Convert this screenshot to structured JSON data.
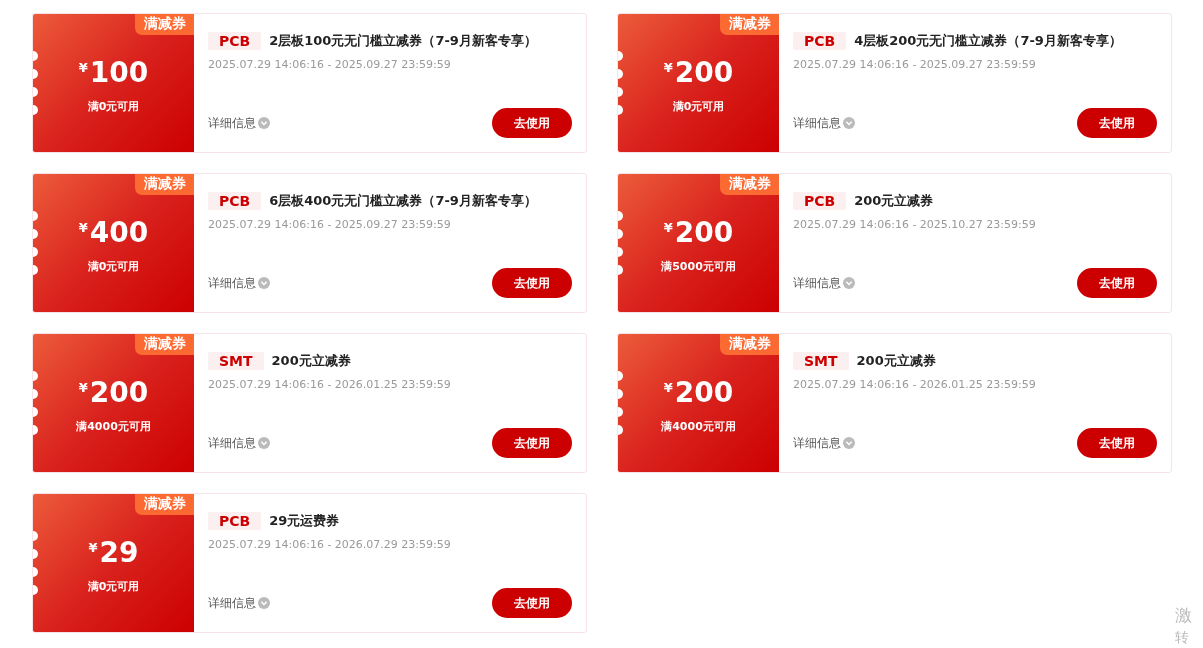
{
  "coupons": [
    {
      "tag": "满减券",
      "currency": "¥",
      "amount": "100",
      "threshold": "满0元可用",
      "category": "PCB",
      "title": "2层板100元无门槛立减券（7-9月新客专享）",
      "validity": "2025.07.29 14:06:16 - 2025.09.27 23:59:59",
      "details": "详细信息",
      "action": "去使用"
    },
    {
      "tag": "满减券",
      "currency": "¥",
      "amount": "200",
      "threshold": "满0元可用",
      "category": "PCB",
      "title": "4层板200元无门槛立减券（7-9月新客专享）",
      "validity": "2025.07.29 14:06:16 - 2025.09.27 23:59:59",
      "details": "详细信息",
      "action": "去使用"
    },
    {
      "tag": "满减券",
      "currency": "¥",
      "amount": "400",
      "threshold": "满0元可用",
      "category": "PCB",
      "title": "6层板400元无门槛立减券（7-9月新客专享）",
      "validity": "2025.07.29 14:06:16 - 2025.09.27 23:59:59",
      "details": "详细信息",
      "action": "去使用"
    },
    {
      "tag": "满减券",
      "currency": "¥",
      "amount": "200",
      "threshold": "满5000元可用",
      "category": "PCB",
      "title": "200元立减券",
      "validity": "2025.07.29 14:06:16 - 2025.10.27 23:59:59",
      "details": "详细信息",
      "action": "去使用"
    },
    {
      "tag": "满减券",
      "currency": "¥",
      "amount": "200",
      "threshold": "满4000元可用",
      "category": "SMT",
      "title": "200元立减券",
      "validity": "2025.07.29 14:06:16 - 2026.01.25 23:59:59",
      "details": "详细信息",
      "action": "去使用"
    },
    {
      "tag": "满减券",
      "currency": "¥",
      "amount": "200",
      "threshold": "满4000元可用",
      "category": "SMT",
      "title": "200元立减券",
      "validity": "2025.07.29 14:06:16 - 2026.01.25 23:59:59",
      "details": "详细信息",
      "action": "去使用"
    },
    {
      "tag": "满减券",
      "currency": "¥",
      "amount": "29",
      "threshold": "满0元可用",
      "category": "PCB",
      "title": "29元运费券",
      "validity": "2025.07.29 14:06:16 - 2026.07.29 23:59:59",
      "details": "详细信息",
      "action": "去使用"
    }
  ],
  "activation_notice": {
    "lines": [
      "激",
      "转"
    ]
  }
}
